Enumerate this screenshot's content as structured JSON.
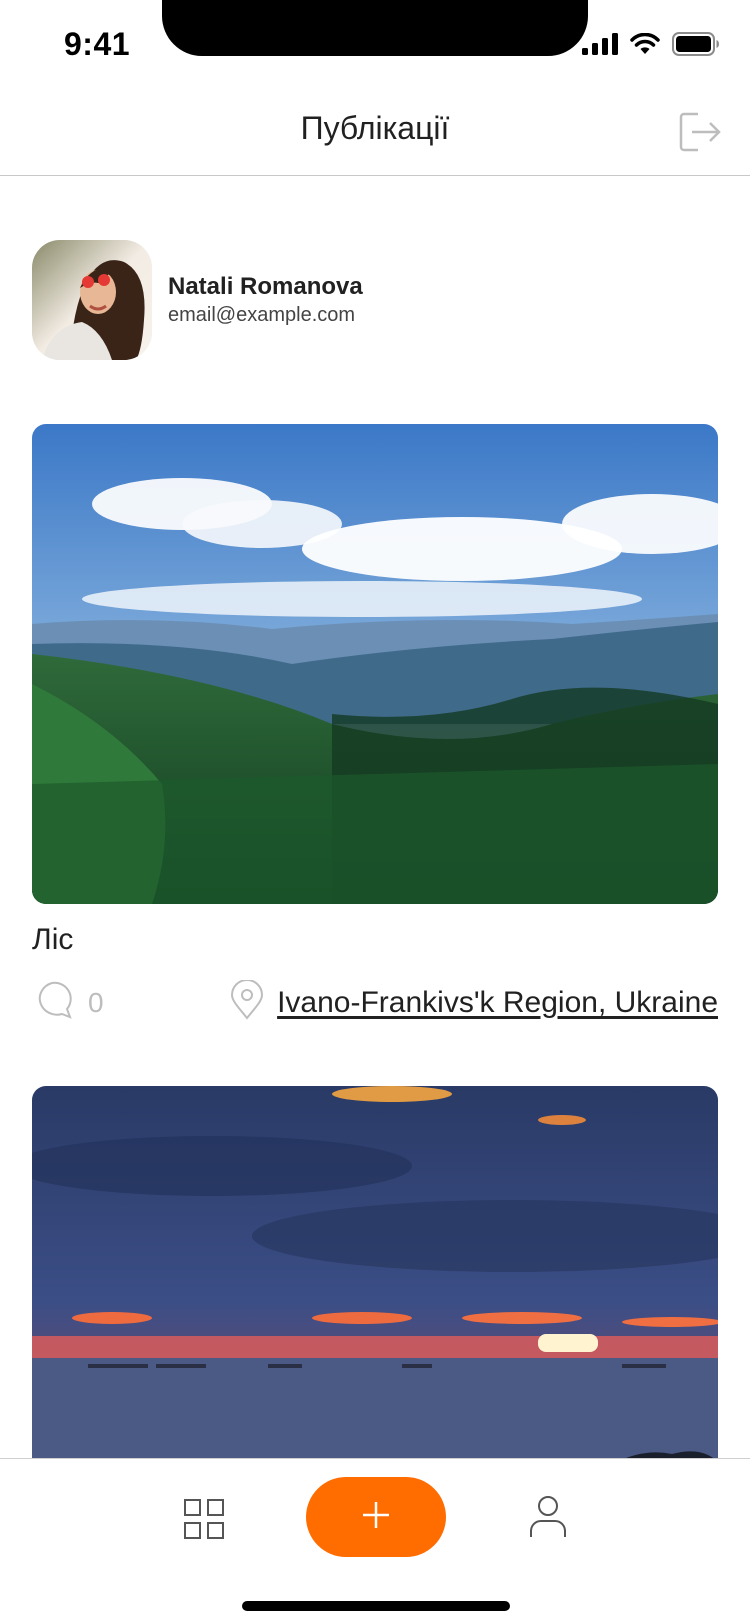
{
  "status_bar": {
    "time": "9:41"
  },
  "header": {
    "title": "Публікації",
    "logout_icon": "logout-icon"
  },
  "profile": {
    "name": "Natali Romanova",
    "email": "email@example.com"
  },
  "posts": [
    {
      "title": "Ліс",
      "comments_count": "0",
      "location": "Ivano-Frankivs'k Region, Ukraine",
      "image": "forest-landscape"
    },
    {
      "image": "sunset-seascape"
    }
  ],
  "tab_bar": {
    "items": [
      "grid-icon",
      "plus-icon",
      "user-icon"
    ]
  },
  "colors": {
    "accent": "#ff6c00",
    "muted": "#bdbdbd",
    "text": "#212121"
  }
}
